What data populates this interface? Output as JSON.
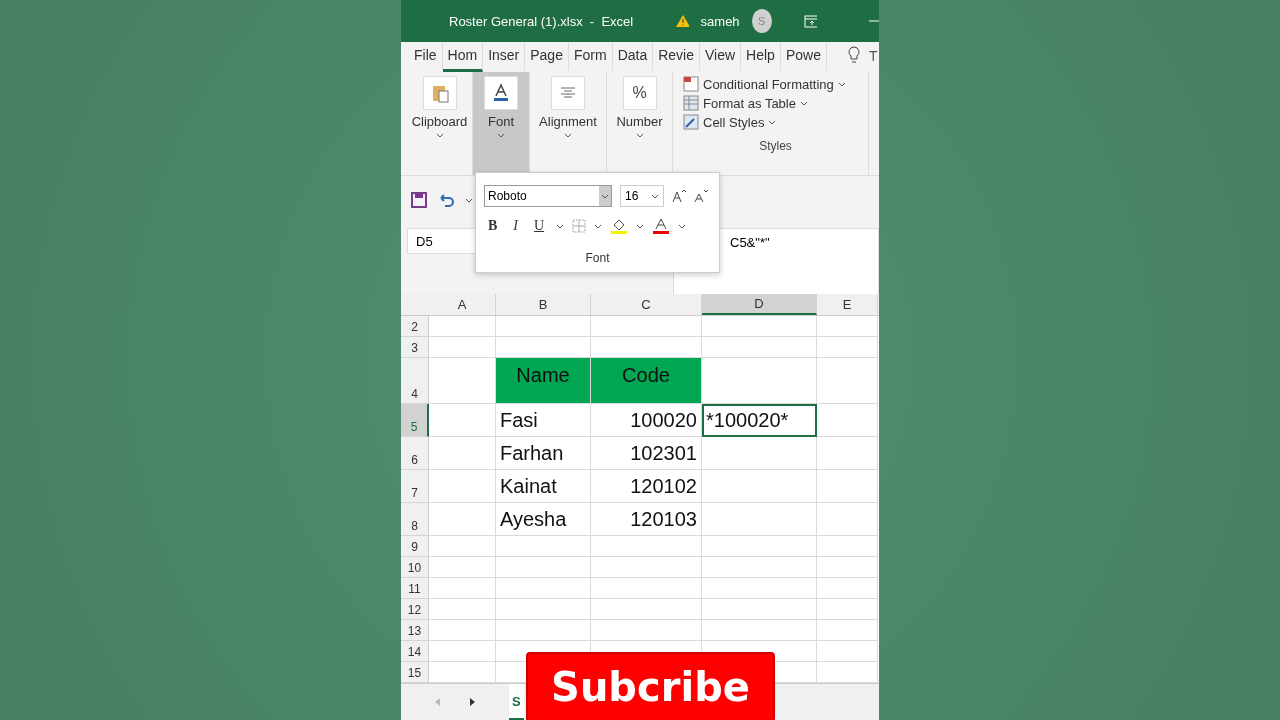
{
  "window": {
    "title": "Roster General (1).xlsx  -  Excel",
    "user": "sameh",
    "avatar": "S"
  },
  "tabs": [
    {
      "label": "File",
      "selected": false
    },
    {
      "label": "Hom",
      "selected": true
    },
    {
      "label": "Inser",
      "selected": false
    },
    {
      "label": "Page",
      "selected": false
    },
    {
      "label": "Form",
      "selected": false
    },
    {
      "label": "Data",
      "selected": false
    },
    {
      "label": "Revie",
      "selected": false
    },
    {
      "label": "View",
      "selected": false
    },
    {
      "label": "Help",
      "selected": false
    },
    {
      "label": "Powe",
      "selected": false
    }
  ],
  "tabs_cut": "T",
  "ribbon": {
    "groups": [
      {
        "kind": "clipboard",
        "label": "Clipboard",
        "selected": false
      },
      {
        "kind": "font",
        "label": "Font",
        "selected": true
      },
      {
        "kind": "alignment",
        "label": "Alignment",
        "selected": false
      },
      {
        "kind": "number",
        "label": "Number",
        "selected": false,
        "glyph": "%"
      }
    ],
    "styles": {
      "items": [
        {
          "kind": "conditional",
          "label": "Conditional Formatting"
        },
        {
          "kind": "table",
          "label": "Format as Table"
        },
        {
          "kind": "cell",
          "label": "Cell Styles"
        }
      ],
      "label": "Styles"
    }
  },
  "font_popup": {
    "font_name": "Roboto",
    "font_size": "16",
    "label": "Font",
    "buttons": [
      {
        "kind": "bold",
        "label": "B"
      },
      {
        "kind": "italic",
        "label": "I"
      },
      {
        "kind": "underline",
        "label": "U"
      }
    ]
  },
  "formula_bar": {
    "name_box": "D5",
    "formula": "C5&\"*\""
  },
  "sheet": {
    "columns": [
      {
        "label": "A",
        "selected": false
      },
      {
        "label": "B",
        "selected": false
      },
      {
        "label": "C",
        "selected": false
      },
      {
        "label": "D",
        "selected": true
      },
      {
        "label": "E",
        "selected": false
      }
    ],
    "rows": [
      {
        "number": "2",
        "kind": "blank",
        "selected": false
      },
      {
        "number": "3",
        "kind": "blank",
        "selected": false
      },
      {
        "number": "4",
        "kind": "header",
        "selected": false,
        "cells": [
          {
            "text": "Name"
          },
          {
            "text": "Code"
          }
        ]
      },
      {
        "number": "5",
        "kind": "data",
        "selected": true,
        "cells": [
          {
            "text": "Fasi"
          },
          {
            "text": "100020"
          },
          {
            "text": "*100020*",
            "selected": true
          }
        ]
      },
      {
        "number": "6",
        "kind": "data",
        "selected": false,
        "cells": [
          {
            "text": "Farhan"
          },
          {
            "text": "102301"
          }
        ]
      },
      {
        "number": "7",
        "kind": "data",
        "selected": false,
        "cells": [
          {
            "text": "Kainat"
          },
          {
            "text": "120102"
          }
        ]
      },
      {
        "number": "8",
        "kind": "data",
        "selected": false,
        "cells": [
          {
            "text": "Ayesha"
          },
          {
            "text": "120103"
          }
        ]
      },
      {
        "number": "9",
        "kind": "blank",
        "selected": false
      },
      {
        "number": "10",
        "kind": "blank",
        "selected": false
      },
      {
        "number": "11",
        "kind": "blank",
        "selected": false
      },
      {
        "number": "12",
        "kind": "blank",
        "selected": false
      },
      {
        "number": "13",
        "kind": "blank",
        "selected": false
      },
      {
        "number": "14",
        "kind": "blank",
        "selected": false
      },
      {
        "number": "15",
        "kind": "blank",
        "selected": false
      }
    ],
    "sheet_tab": "S"
  },
  "overlay": {
    "label": "Subcribe"
  }
}
